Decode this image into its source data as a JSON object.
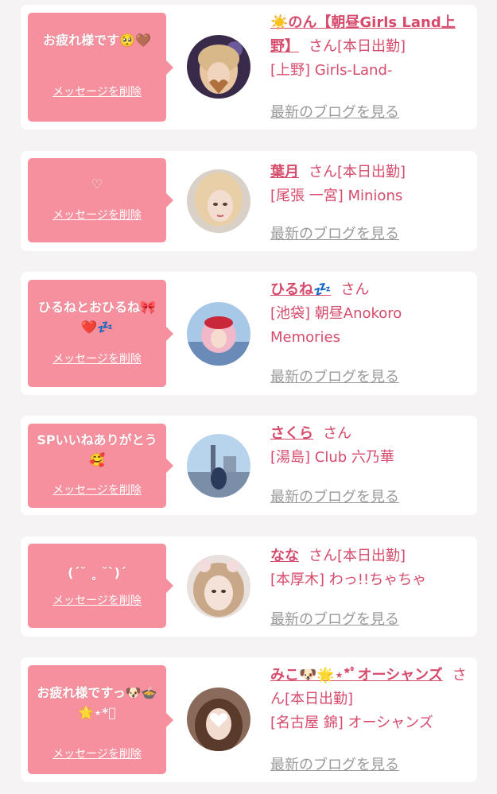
{
  "colors": {
    "accent": "#d64b6c",
    "bubble": "#f7909e",
    "link_gray": "#999999",
    "page_bg": "#f5f3f3"
  },
  "items": [
    {
      "message": "お疲れ様です🥺🤎",
      "delete_label": "メッセージを削除",
      "name": "☀️のん【朝昼Girls Land上野】",
      "san": "さん",
      "status": "[本日出勤]",
      "shop": "[上野] Girls-Land-",
      "blog_label": "最新のブログを見る"
    },
    {
      "message": "♡",
      "delete_label": "メッセージを削除",
      "name": "葉月",
      "san": "さん",
      "status": "[本日出勤]",
      "shop": "[尾張 一宮] Minions",
      "blog_label": "最新のブログを見る"
    },
    {
      "message": "ひるねとおひるね🎀❤️💤",
      "delete_label": "メッセージを削除",
      "name": "ひるね💤",
      "san": "さん",
      "status": "",
      "shop": "[池袋] 朝昼Anokoro Memories",
      "blog_label": "最新のブログを見る"
    },
    {
      "message": "SPいいねありがとう🥰",
      "delete_label": "メッセージを削除",
      "name": "さくら",
      "san": "さん",
      "status": "",
      "shop": "[湯島] Club 六乃華",
      "blog_label": "最新のブログを見る"
    },
    {
      "message": "(ˊ˘ ˳ ˘ˋ)ˊ",
      "delete_label": "メッセージを削除",
      "name": "なな",
      "san": "さん",
      "status": "[本日出勤]",
      "shop": "[本厚木] わっ!!ちゃちゃ",
      "blog_label": "最新のブログを見る"
    },
    {
      "message": "お疲れ様ですっ🐶🍲🌟⋆*ﾟ",
      "delete_label": "メッセージを削除",
      "name": "みこ🐶🌟⋆*ﾟオーシャンズ",
      "san": "さん",
      "status": "[本日出勤]",
      "shop": "[名古屋 錦] オーシャンズ",
      "blog_label": "最新のブログを見る"
    }
  ]
}
